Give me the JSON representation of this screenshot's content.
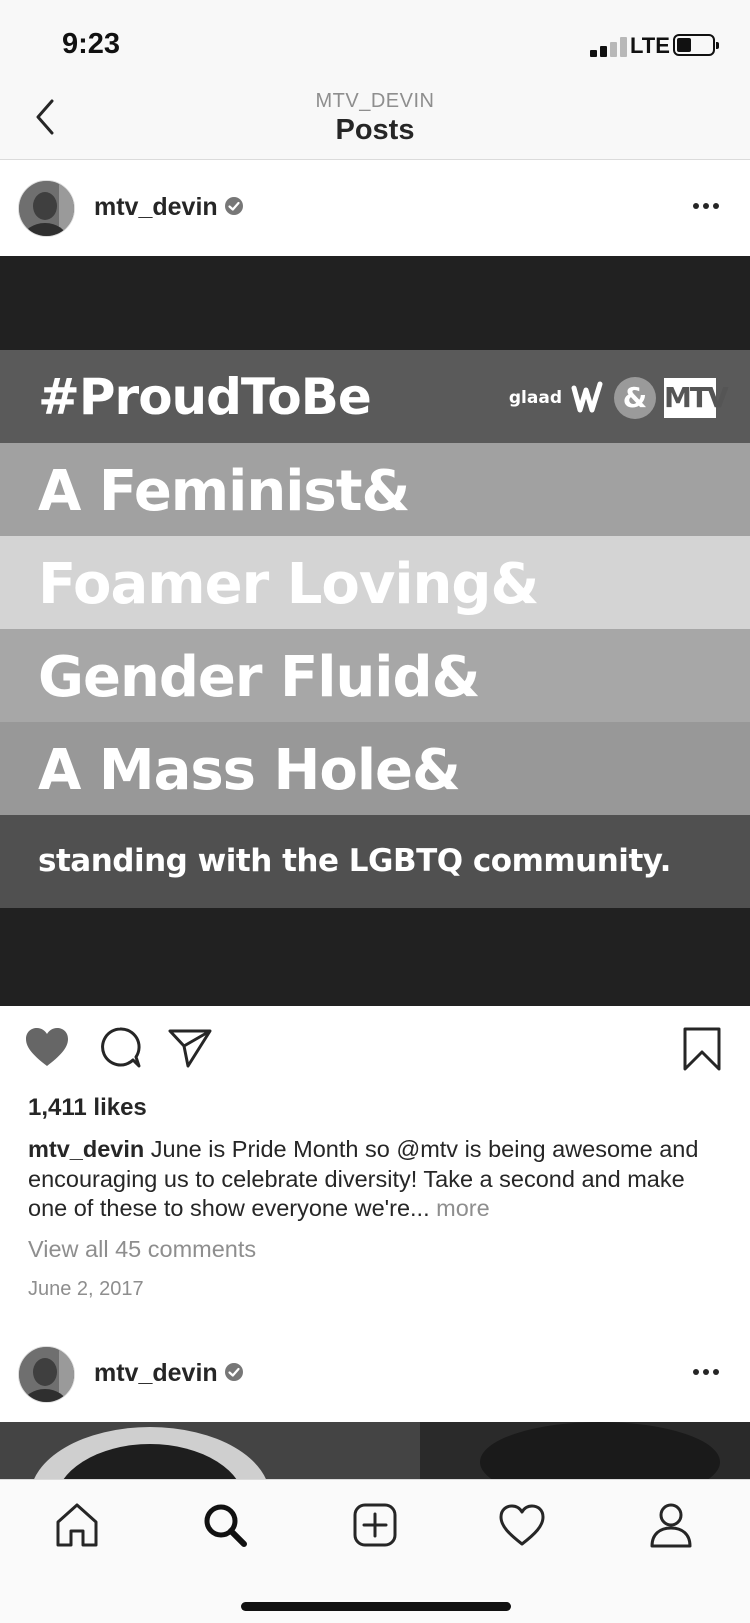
{
  "status_bar": {
    "time": "9:23",
    "network": "LTE"
  },
  "nav": {
    "subtitle": "MTV_DEVIN",
    "title": "Posts"
  },
  "post": {
    "username": "mtv_devin",
    "image_lines": {
      "hashtag": "#ProudToBe",
      "glaad": "glaad",
      "amp": "&",
      "mtv": "MTV",
      "line1": "A Feminist&",
      "line2": "Foamer Loving&",
      "line3": "Gender Fluid&",
      "line4": "A Mass Hole&",
      "footer": "standing with the LGBTQ community."
    },
    "likes": "1,411 likes",
    "caption_user": "mtv_devin",
    "caption_text": "June is Pride Month so @mtv is being awesome and encouraging us to celebrate diversity! Take a second and make one of these to show everyone we're...",
    "caption_more": "more",
    "view_comments": "View all 45 comments",
    "date": "June 2, 2017"
  },
  "next_post": {
    "username": "mtv_devin"
  },
  "icons": {
    "back": "chevron-left-icon",
    "verified": "verified-badge-icon",
    "more": "more-horizontal-icon",
    "like": "heart-filled-icon",
    "comment": "comment-icon",
    "share": "send-icon",
    "save": "bookmark-icon",
    "tabs": [
      "home-icon",
      "search-icon",
      "add-post-icon",
      "activity-heart-icon",
      "profile-icon"
    ]
  },
  "colors": {
    "band_dark": "#595959",
    "band_mid": "#a0a0a0",
    "band_light": "#d3d3d3",
    "band_gender": "#a6a6a6",
    "band_mass": "#979797",
    "band_footer": "#505050",
    "like_fill": "#666666"
  }
}
